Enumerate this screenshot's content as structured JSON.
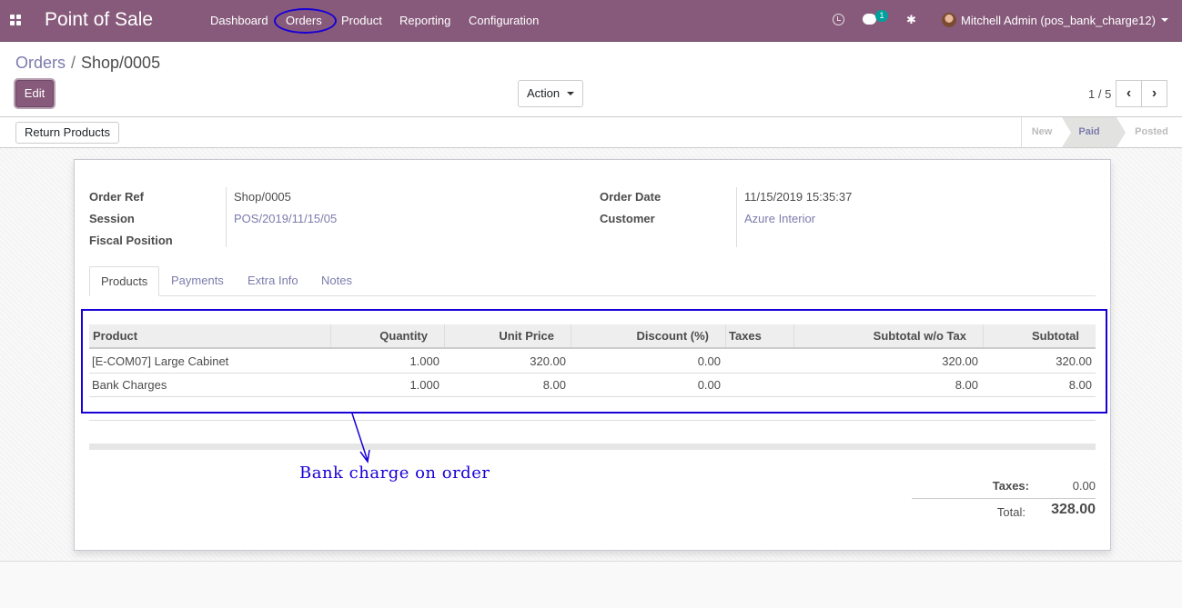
{
  "navbar": {
    "brand": "Point of Sale",
    "menu": [
      "Dashboard",
      "Orders",
      "Product",
      "Reporting",
      "Configuration"
    ],
    "messages_badge": "1",
    "user": "Mitchell Admin (pos_bank_charge12)"
  },
  "breadcrumb": {
    "parent": "Orders",
    "separator": "/",
    "current": "Shop/0005"
  },
  "toolbar": {
    "edit_label": "Edit",
    "action_label": "Action",
    "pager": "1 / 5"
  },
  "status": {
    "return_label": "Return Products",
    "stages": [
      "New",
      "Paid",
      "Posted"
    ],
    "active_stage": "Paid"
  },
  "form": {
    "left": [
      {
        "label": "Order Ref",
        "value": "Shop/0005"
      },
      {
        "label": "Session",
        "value": "POS/2019/11/15/05"
      },
      {
        "label": "Fiscal Position",
        "value": ""
      }
    ],
    "right": [
      {
        "label": "Order Date",
        "value": "11/15/2019 15:35:37"
      },
      {
        "label": "Customer",
        "value": "Azure Interior"
      }
    ]
  },
  "tabs": [
    "Products",
    "Payments",
    "Extra Info",
    "Notes"
  ],
  "lines": {
    "headers": [
      "Product",
      "Quantity",
      "Unit Price",
      "Discount (%)",
      "Taxes",
      "Subtotal w/o Tax",
      "Subtotal"
    ],
    "rows": [
      [
        "[E-COM07] Large Cabinet",
        "1.000",
        "320.00",
        "0.00",
        "",
        "320.00",
        "320.00"
      ],
      [
        "Bank Charges",
        "1.000",
        "8.00",
        "0.00",
        "",
        "8.00",
        "8.00"
      ]
    ]
  },
  "totals": {
    "taxes_label": "Taxes:",
    "taxes": "0.00",
    "total_label": "Total:",
    "total": "328.00"
  },
  "annotation": "Bank charge on order",
  "colors": {
    "brand": "#875a7b",
    "link": "#7c7bad",
    "annotation": "#1800d6"
  }
}
